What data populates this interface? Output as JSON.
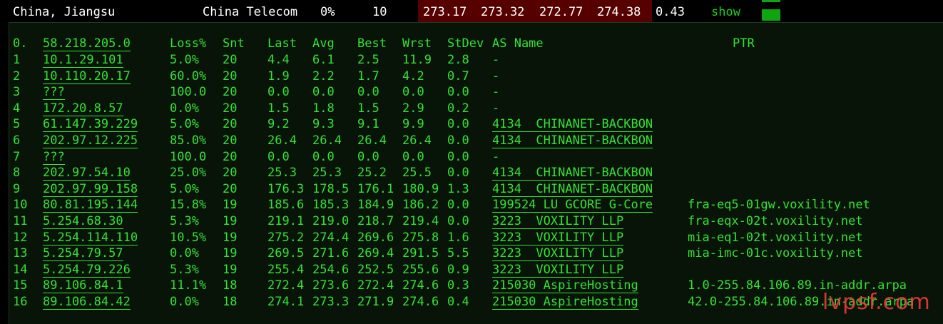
{
  "summary": {
    "location": "China, Jiangsu",
    "isp": "China Telecom",
    "loss": "0%",
    "sent": "10",
    "last": "273.17",
    "avg": "273.32",
    "best": "272.77",
    "worst": "274.38",
    "stdev": "0.43",
    "show_label": "show",
    "status_color": "#0ea50e",
    "latency_bg_color": "#560000"
  },
  "table": {
    "headers": {
      "hop": "0.",
      "host": "58.218.205.0",
      "loss": "Loss%",
      "snt": "Snt",
      "last": "Last",
      "avg": "Avg",
      "best": "Best",
      "wrst": "Wrst",
      "stdev": "StDev",
      "asname": "AS Name",
      "ptr": "PTR"
    },
    "rows": [
      {
        "hop": "1",
        "host": "10.1.29.101",
        "loss": "5.0%",
        "snt": "20",
        "last": "4.4",
        "avg": "6.1",
        "best": "2.5",
        "wrst": "11.9",
        "stdev": "2.8",
        "asname": "-",
        "ptr": ""
      },
      {
        "hop": "2",
        "host": "10.110.20.17",
        "loss": "60.0%",
        "snt": "20",
        "last": "1.9",
        "avg": "2.2",
        "best": "1.7",
        "wrst": "4.2",
        "stdev": "0.7",
        "asname": "-",
        "ptr": ""
      },
      {
        "hop": "3",
        "host": "???",
        "loss": "100.0",
        "snt": "20",
        "last": "0.0",
        "avg": "0.0",
        "best": "0.0",
        "wrst": "0.0",
        "stdev": "0.0",
        "asname": "-",
        "ptr": ""
      },
      {
        "hop": "4",
        "host": "172.20.8.57",
        "loss": "0.0%",
        "snt": "20",
        "last": "1.5",
        "avg": "1.8",
        "best": "1.5",
        "wrst": "2.9",
        "stdev": "0.2",
        "asname": "-",
        "ptr": ""
      },
      {
        "hop": "5",
        "host": "61.147.39.229",
        "loss": "5.0%",
        "snt": "20",
        "last": "9.2",
        "avg": "9.3",
        "best": "9.1",
        "wrst": "9.9",
        "stdev": "0.0",
        "asname": "4134  CHINANET-BACKBON",
        "ptr": ""
      },
      {
        "hop": "6",
        "host": "202.97.12.225",
        "loss": "85.0%",
        "snt": "20",
        "last": "26.4",
        "avg": "26.4",
        "best": "26.4",
        "wrst": "26.4",
        "stdev": "0.0",
        "asname": "4134  CHINANET-BACKBON",
        "ptr": ""
      },
      {
        "hop": "7",
        "host": "???",
        "loss": "100.0",
        "snt": "20",
        "last": "0.0",
        "avg": "0.0",
        "best": "0.0",
        "wrst": "0.0",
        "stdev": "0.0",
        "asname": "-",
        "ptr": ""
      },
      {
        "hop": "8",
        "host": "202.97.54.10",
        "loss": "25.0%",
        "snt": "20",
        "last": "25.3",
        "avg": "25.3",
        "best": "25.2",
        "wrst": "25.5",
        "stdev": "0.0",
        "asname": "4134  CHINANET-BACKBON",
        "ptr": ""
      },
      {
        "hop": "9",
        "host": "202.97.99.158",
        "loss": "5.0%",
        "snt": "20",
        "last": "176.3",
        "avg": "178.5",
        "best": "176.1",
        "wrst": "180.9",
        "stdev": "1.3",
        "asname": "4134  CHINANET-BACKBON",
        "ptr": ""
      },
      {
        "hop": "10",
        "host": "80.81.195.144",
        "loss": "15.8%",
        "snt": "19",
        "last": "185.6",
        "avg": "185.3",
        "best": "184.9",
        "wrst": "186.2",
        "stdev": "0.0",
        "asname": "199524 LU GCORE G-Core",
        "ptr": "fra-eq5-01gw.voxility.net"
      },
      {
        "hop": "11",
        "host": "5.254.68.30",
        "loss": "5.3%",
        "snt": "19",
        "last": "219.1",
        "avg": "219.0",
        "best": "218.7",
        "wrst": "219.4",
        "stdev": "0.0",
        "asname": "3223  VOXILITY LLP",
        "ptr": "fra-eqx-02t.voxility.net"
      },
      {
        "hop": "12",
        "host": "5.254.114.110",
        "loss": "10.5%",
        "snt": "19",
        "last": "275.2",
        "avg": "274.4",
        "best": "269.6",
        "wrst": "275.8",
        "stdev": "1.6",
        "asname": "3223  VOXILITY LLP",
        "ptr": "mia-eq1-02t.voxility.net"
      },
      {
        "hop": "13",
        "host": "5.254.79.57",
        "loss": "0.0%",
        "snt": "19",
        "last": "269.5",
        "avg": "271.6",
        "best": "269.4",
        "wrst": "291.5",
        "stdev": "5.5",
        "asname": "3223  VOXILITY LLP",
        "ptr": "mia-imc-01c.voxility.net"
      },
      {
        "hop": "14",
        "host": "5.254.79.226",
        "loss": "5.3%",
        "snt": "19",
        "last": "255.4",
        "avg": "254.6",
        "best": "252.5",
        "wrst": "255.6",
        "stdev": "0.9",
        "asname": "3223  VOXILITY LLP",
        "ptr": ""
      },
      {
        "hop": "15",
        "host": "89.106.84.1",
        "loss": "11.1%",
        "snt": "18",
        "last": "272.4",
        "avg": "273.6",
        "best": "272.4",
        "wrst": "274.6",
        "stdev": "0.3",
        "asname": "215030 AspireHosting",
        "ptr": "1.0-255.84.106.89.in-addr.arpa"
      },
      {
        "hop": "16",
        "host": "89.106.84.42",
        "loss": "0.0%",
        "snt": "18",
        "last": "274.1",
        "avg": "273.3",
        "best": "271.9",
        "wrst": "274.6",
        "stdev": "0.4",
        "asname": "215030 AspireHosting",
        "ptr": "42.0-255.84.106.89.in-addr.arpa"
      }
    ]
  },
  "watermark": "lvpsf.com"
}
